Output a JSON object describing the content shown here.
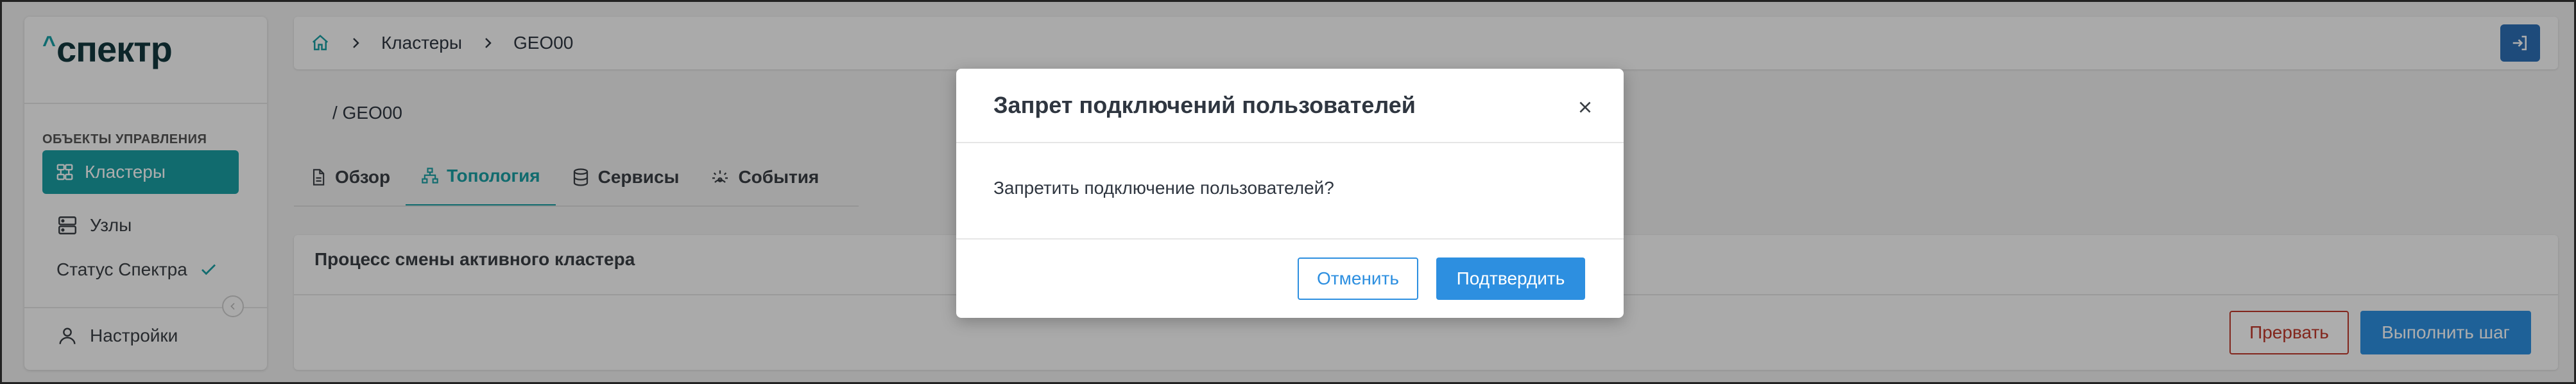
{
  "app": {
    "logo_text": "спектр",
    "logo_caret": "^"
  },
  "sidebar": {
    "section_title": "ОБЪЕКТЫ УПРАВЛЕНИЯ",
    "items": [
      {
        "label": "Кластеры",
        "icon": "clusters-icon",
        "active": true
      },
      {
        "label": "Узлы",
        "icon": "nodes-icon",
        "active": false
      }
    ],
    "status_label": "Статус Спектра",
    "settings_label": "Настройки"
  },
  "breadcrumb": {
    "home_icon": "home-icon",
    "items": [
      "Кластеры",
      "GEO00"
    ]
  },
  "page": {
    "subtitle": "/ GEO00",
    "tabs": [
      {
        "label": "Обзор",
        "icon": "document-icon",
        "active": false
      },
      {
        "label": "Топология",
        "icon": "topology-icon",
        "active": true
      },
      {
        "label": "Сервисы",
        "icon": "database-icon",
        "active": false
      },
      {
        "label": "События",
        "icon": "events-icon",
        "active": false
      }
    ],
    "panel_title": "Процесс смены активного кластера",
    "abort_label": "Прервать",
    "step_label": "Выполнить шаг"
  },
  "modal": {
    "title": "Запрет подключений пользователей",
    "body": "Запретить подключение пользователей?",
    "cancel_label": "Отменить",
    "confirm_label": "Подтвердить"
  },
  "colors": {
    "accent": "#1a9ea3",
    "primary": "#2d8fe0",
    "danger": "#c0392b",
    "overlay": "rgba(0,0,0,0.32)"
  }
}
